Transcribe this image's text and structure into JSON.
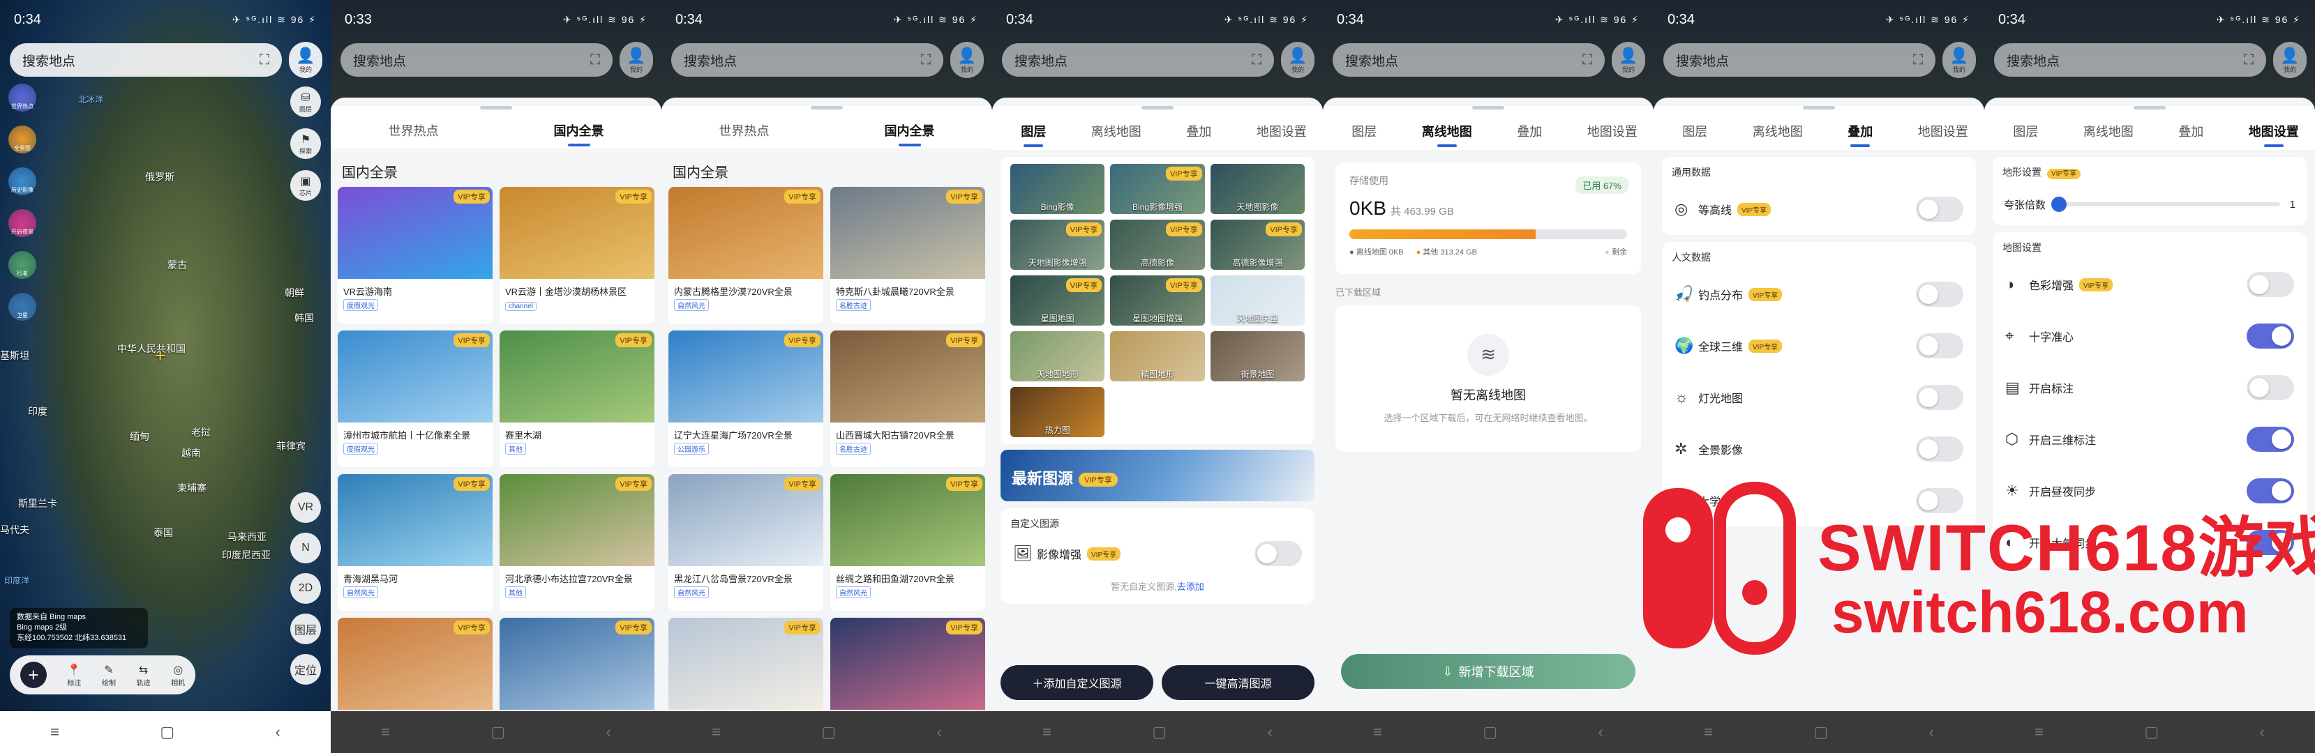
{
  "status": {
    "time": "0:34",
    "time_alt": "0:33",
    "icons": "✈ ⁵ᴳ.ıll ≋ 96 ⚡"
  },
  "search": {
    "placeholder": "搜索地点"
  },
  "user": {
    "label": "我的"
  },
  "screen1": {
    "map_labels": {
      "beibingyang": "北冰洋",
      "elos": "俄罗斯",
      "menggu": "蒙古",
      "zhongguo": "中华人民共和国",
      "chaoxian": "朝鲜",
      "hanguo": "韩国",
      "yindu": "印度",
      "jiji": "基斯坦",
      "miandian": "缅甸",
      "laowo": "老挝",
      "yuenan": "越南",
      "feilvbin": "菲律宾",
      "jianpuzhai": "柬埔寨",
      "malaixiya": "马来西亚",
      "yindunixiya": "印度尼西亚",
      "silanka": "斯里兰卡",
      "yinduyang": "印度洋",
      "taiguo": "泰国",
      "madaiv": "马代夫"
    },
    "left_buttons": [
      "世界热点",
      "全景图",
      "历史影像",
      "开启夜景",
      "行者",
      "卫星"
    ],
    "right_buttons": [
      {
        "icon": "layers",
        "label": "图层"
      },
      {
        "icon": "flag",
        "label": "探索"
      },
      {
        "icon": "chip",
        "label": "芯片"
      }
    ],
    "right_lower": [
      {
        "label": "VR"
      },
      {
        "label": "N"
      },
      {
        "label": "2D"
      },
      {
        "label": "图层"
      },
      {
        "label": "定位"
      }
    ],
    "info": {
      "line1": "数据来自 Bing maps",
      "line2": "Bing maps  2级",
      "line3": "东经100.753502 北纬33.638531"
    },
    "bottom": [
      {
        "icon": "📍",
        "label": "标注"
      },
      {
        "icon": "✎",
        "label": "绘制"
      },
      {
        "icon": "⇆",
        "label": "轨迹"
      },
      {
        "icon": "◎",
        "label": "相机"
      }
    ]
  },
  "tabs_hot": [
    "世界热点",
    "国内全景"
  ],
  "section_domestic": "国内全景",
  "vip_label": "VIP专享",
  "screen2": {
    "cards": [
      {
        "title": "VR云游海南",
        "tag": "度假观光",
        "colors": [
          "#7b4fd6",
          "#33a6e8"
        ]
      },
      {
        "title": "VR云游丨金塔沙漠胡杨林景区",
        "tag": "channel",
        "colors": [
          "#c9882f",
          "#e8c26b"
        ]
      },
      {
        "title": "漳州市城市航拍丨十亿像素全景",
        "tag": "度假观光",
        "colors": [
          "#3a8ccf",
          "#9fd0f0"
        ]
      },
      {
        "title": "赛里木湖",
        "tag": "其他",
        "colors": [
          "#4e8f4a",
          "#a5c97b"
        ]
      },
      {
        "title": "青海湖黑马河",
        "tag": "自然风光",
        "colors": [
          "#2f7fb8",
          "#9ad3f0"
        ]
      },
      {
        "title": "河北承德小布达拉宫720VR全景",
        "tag": "其他",
        "colors": [
          "#5a8f3d",
          "#d4c2a0"
        ]
      },
      {
        "title": "",
        "tag": "",
        "colors": [
          "#c97a3a",
          "#e6b98a"
        ]
      },
      {
        "title": "",
        "tag": "",
        "colors": [
          "#3b6ea5",
          "#a8c5e0"
        ]
      }
    ]
  },
  "screen3": {
    "cards": [
      {
        "title": "内蒙古腾格里沙漠720VR全景",
        "tag": "自然风光",
        "colors": [
          "#c27a2e",
          "#e8b46c"
        ]
      },
      {
        "title": "特克斯八卦城晨曦720VR全景",
        "tag": "名胜古迹",
        "colors": [
          "#6d7a8a",
          "#c9c2a8"
        ]
      },
      {
        "title": "辽宁大连星海广场720VR全景",
        "tag": "公园游乐",
        "colors": [
          "#2f7fc8",
          "#a4cdea"
        ]
      },
      {
        "title": "山西晋城大阳古镇720VR全景",
        "tag": "名胜古迹",
        "colors": [
          "#7a5a3a",
          "#c4a57a"
        ]
      },
      {
        "title": "黑龙江八岔岛雪景720VR全景",
        "tag": "自然风光",
        "colors": [
          "#8aa3bf",
          "#e6eef6"
        ]
      },
      {
        "title": "丝绸之路和田鱼湖720VR全景",
        "tag": "自然风光",
        "colors": [
          "#4f7a3a",
          "#a7c77a"
        ]
      },
      {
        "title": "",
        "tag": "",
        "colors": [
          "#b8c6d6",
          "#f2ede4"
        ]
      },
      {
        "title": "",
        "tag": "",
        "colors": [
          "#2b3a6a",
          "#c86a8a"
        ]
      }
    ]
  },
  "tabs_main": [
    "图层",
    "离线地图",
    "叠加",
    "地图设置"
  ],
  "screen4": {
    "tiles": [
      {
        "label": "Bing影像",
        "vip": false,
        "colors": [
          "#2f5a78",
          "#6f8f6a"
        ]
      },
      {
        "label": "Bing影像增强",
        "vip": true,
        "colors": [
          "#3a6a7a",
          "#7a9a7a"
        ]
      },
      {
        "label": "天地图影像",
        "vip": false,
        "colors": [
          "#2e4f5e",
          "#6a8a6a"
        ]
      },
      {
        "label": "天地图影像增强",
        "vip": true,
        "colors": [
          "#3a5a5a",
          "#8aa08a"
        ]
      },
      {
        "label": "高德影像",
        "vip": true,
        "colors": [
          "#3c5a50",
          "#7a8f7a"
        ]
      },
      {
        "label": "高德影像增强",
        "vip": true,
        "colors": [
          "#355550",
          "#80967d"
        ]
      },
      {
        "label": "星图地图",
        "vip": true,
        "colors": [
          "#2c4a4a",
          "#6f8a70"
        ]
      },
      {
        "label": "星图地图增强",
        "vip": true,
        "colors": [
          "#34504a",
          "#788f74"
        ]
      },
      {
        "label": "天地图矢量",
        "vip": false,
        "colors": [
          "#cfe0ea",
          "#e8eef2"
        ]
      },
      {
        "label": "天地图地形",
        "vip": false,
        "colors": [
          "#7a9a6a",
          "#c4c49a"
        ]
      },
      {
        "label": "精图地形",
        "vip": false,
        "colors": [
          "#b89a5a",
          "#d8c49a"
        ]
      },
      {
        "label": "街景地图",
        "vip": false,
        "colors": [
          "#6a5a4a",
          "#aa9a8a"
        ]
      },
      {
        "label": "热力图",
        "vip": false,
        "colors": [
          "#5a3a1a",
          "#c8842a"
        ]
      }
    ],
    "banner": {
      "badge": "最新图源",
      "title": "最新图源",
      "vip": "VIP专享"
    },
    "custom_header": "自定义图源",
    "custom_row": {
      "label": "影像增强",
      "vip": "VIP专享"
    },
    "empty_text": "暂无自定义图源,",
    "empty_link": "去添加",
    "btn_add": "添加自定义图源",
    "btn_hd": "一键高清图源"
  },
  "screen5": {
    "storage_label": "存储使用",
    "used_badge": "已用 67%",
    "amount": "0KB",
    "total": "共 463.99 GB",
    "used_fraction": 0.67,
    "legend": [
      "离线地图 0KB",
      "其他 313.24 GB",
      "剩余"
    ],
    "downloaded_label": "已下载区域",
    "empty_title": "暂无离线地图",
    "empty_sub": "选择一个区域下载后，可在无网络时继续查看地图。",
    "download_btn": "新增下载区域"
  },
  "screen6": {
    "sec1": "通用数据",
    "sec1_rows": [
      {
        "icon": "◎",
        "label": "等高线",
        "vip": true,
        "on": false
      }
    ],
    "sec2": "人文数据",
    "sec2_rows": [
      {
        "icon": "🎣",
        "label": "钓点分布",
        "vip": true,
        "on": false
      },
      {
        "icon": "🌍",
        "label": "全球三维",
        "vip": true,
        "on": false
      },
      {
        "icon": "☼",
        "label": "灯光地图",
        "vip": false,
        "on": false
      },
      {
        "icon": "✲",
        "label": "全景影像",
        "vip": false,
        "on": false
      },
      {
        "icon": "◒",
        "label": "大学",
        "vip": false,
        "on": false
      }
    ]
  },
  "screen7": {
    "sec1": "地形设置",
    "sec1_vip": "VIP专享",
    "slider_label": "夸张倍数",
    "slider_value": "1",
    "sec2": "地图设置",
    "rows": [
      {
        "icon": "◑",
        "label": "色彩增强",
        "vip": true,
        "on": false
      },
      {
        "icon": "⌖",
        "label": "十字准心",
        "vip": false,
        "on": true
      },
      {
        "icon": "▤",
        "label": "开启标注",
        "vip": false,
        "on": false
      },
      {
        "icon": "⬡",
        "label": "开启三维标注",
        "vip": false,
        "on": true
      },
      {
        "icon": "☀",
        "label": "开启昼夜同步",
        "vip": false,
        "on": true
      },
      {
        "icon": "◐",
        "label": "开启大气同步",
        "vip": false,
        "on": true
      }
    ]
  },
  "nav": {
    "menu": "≡",
    "home": "▢",
    "back": "‹"
  },
  "watermark": {
    "line1": "SWITCH618游戏",
    "line2": "switch618.com"
  }
}
